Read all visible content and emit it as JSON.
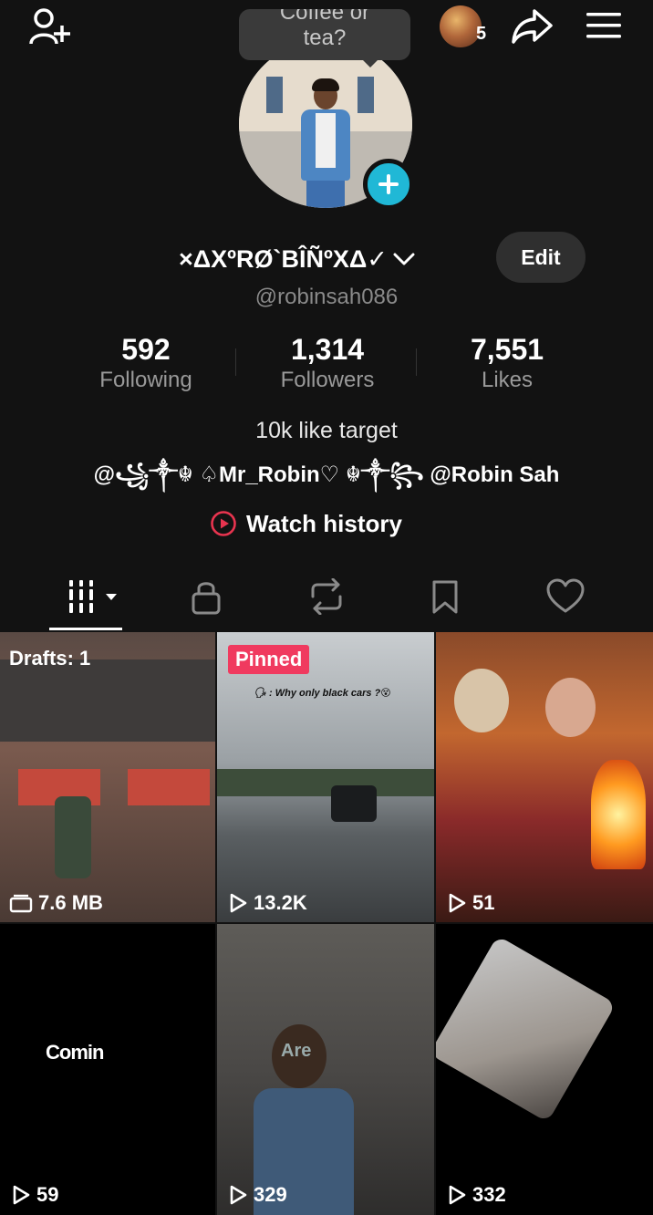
{
  "topbar": {
    "story_count": "5"
  },
  "bubble": {
    "line1": "Coffee or",
    "line2": "tea?"
  },
  "profile": {
    "display_name": "×ΔXºRØ`BÎÑºXΔ✓",
    "edit_label": "Edit",
    "username": "@robinsah086"
  },
  "stats": [
    {
      "value": "592",
      "label": "Following"
    },
    {
      "value": "1,314",
      "label": "Followers"
    },
    {
      "value": "7,551",
      "label": "Likes"
    }
  ],
  "bio": {
    "line1": "10k like target",
    "line2": "@꧁༒☬ ♤Mr_Robin♡ ☬༒꧂ @Robin Sah"
  },
  "watch_history": "Watch history",
  "tabs": [
    "videos",
    "private",
    "reposts",
    "favorites",
    "liked"
  ],
  "grid": [
    {
      "badge": "Drafts: 1",
      "stat": "7.6 MB",
      "kind": "draft"
    },
    {
      "badge": "Pinned",
      "stat": "13.2K",
      "caption": "🗣 : Why only black cars ?😵",
      "kind": "video"
    },
    {
      "stat": "51",
      "kind": "video"
    },
    {
      "stat": "59",
      "caption": "Comin",
      "kind": "video"
    },
    {
      "stat": "329",
      "caption": "Are",
      "kind": "video"
    },
    {
      "stat": "332",
      "kind": "video"
    }
  ],
  "colors": {
    "background": "#121212",
    "accent_cyan": "#20b8d6",
    "pinned_red": "#f03a5f",
    "watch_icon_red": "#e8344f"
  }
}
